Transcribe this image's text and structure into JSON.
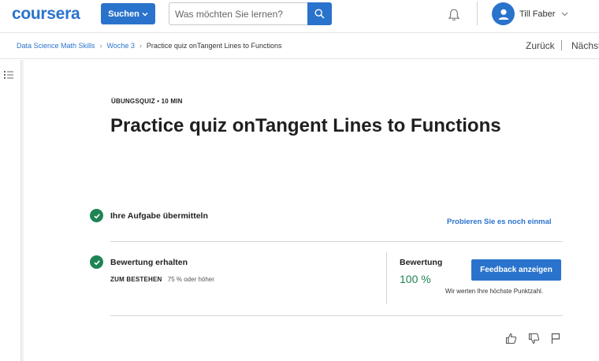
{
  "header": {
    "logo_text": "coursera",
    "search_dropdown_label": "Suchen",
    "search_placeholder": "Was möchten Sie lernen?",
    "user_name": "Till Faber"
  },
  "breadcrumb": {
    "items": [
      "Data Science Math Skills",
      "Woche 3"
    ],
    "current": "Practice quiz onTangent Lines to Functions",
    "back_label": "Zurück",
    "next_label": "Nächst"
  },
  "main": {
    "eyebrow": "ÜBUNGSQUIZ • 10 MIN",
    "title": "Practice quiz onTangent Lines to Functions",
    "submit_label": "Ihre Aufgabe übermitteln",
    "retry_label": "Probieren Sie es noch einmal",
    "grade_label": "Bewertung erhalten",
    "pass_key": "ZUM BESTEHEN",
    "pass_value": "75 % oder höher",
    "score_label": "Bewertung",
    "score_value": "100 %",
    "feedback_button": "Feedback anzeigen",
    "score_note": "Wir werten Ihre höchste Punktzahl."
  },
  "colors": {
    "brand": "#2a73cc",
    "success": "#1f8354"
  },
  "icons": [
    "search-icon",
    "bell-icon",
    "user-avatar-icon",
    "chevron-down-icon",
    "list-icon",
    "check-icon",
    "thumbs-up-icon",
    "thumbs-down-icon",
    "flag-icon"
  ]
}
